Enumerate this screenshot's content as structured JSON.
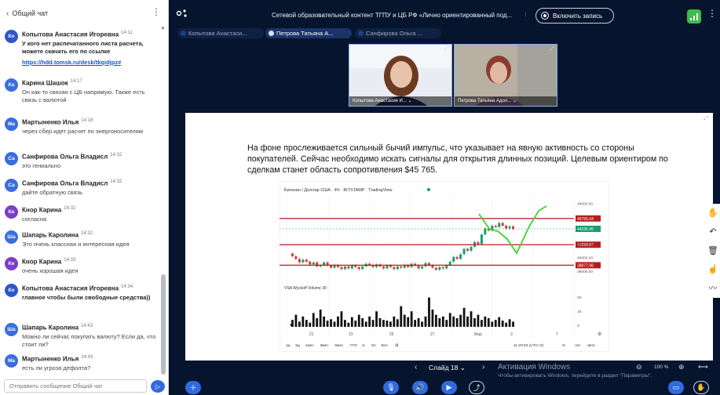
{
  "chat": {
    "title": "Общий чат",
    "back_icon": "chevron-left-icon",
    "input_placeholder": "Отправить сообщение Общий чат",
    "messages": [
      {
        "initials": "Ко",
        "color": "#2f56c9",
        "author": "Копытова Анастасия Игоревна",
        "time": "14:11",
        "text": "У кого нет распечатанного листа расчета, можете скачать его по ссылке",
        "bold": true,
        "link": "https://hdd.tomsk.ru/desk/tkqidjpz#"
      },
      {
        "initials": "Ка",
        "color": "#3a6ee0",
        "author": "Карина Шашок",
        "time": "14:17",
        "text": "Он как-то связан с ЦБ напрямую. Также есть связь с валютой",
        "bold": false
      },
      {
        "initials": "Ма",
        "color": "#3a6ee0",
        "author": "Мартыненко Илья",
        "time": "14:18",
        "text": "через сбер идет расчет по энергоносителям",
        "bold": false
      },
      {
        "initials": "Са",
        "color": "#3a6ee0",
        "author": "Санфирова Ольга Владисл",
        "time": "14:32",
        "text": "это гениально",
        "bold": false
      },
      {
        "initials": "Са",
        "color": "#3a6ee0",
        "author": "Санфирова Ольга Владисл",
        "time": "14:32",
        "text": "дайте обратную связь",
        "bold": false
      },
      {
        "initials": "Кн",
        "color": "#7a3fc4",
        "author": "Кнор Карина",
        "time": "14:32",
        "text": "согласна",
        "bold": false
      },
      {
        "initials": "Ша",
        "color": "#3a6ee0",
        "author": "Шапарь Каролина",
        "time": "14:32",
        "text": "Это очень классная и интересная идея",
        "bold": false
      },
      {
        "initials": "Кн",
        "color": "#7a3fc4",
        "author": "Кнор Карина",
        "time": "14:33",
        "text": "очень хорошая идея",
        "bold": false
      },
      {
        "initials": "Ко",
        "color": "#2f56c9",
        "author": "Копытова Анастасия Игоревна",
        "time": "14:34",
        "text": "главное чтобы были свободные средства))",
        "bold": true
      },
      {
        "initials": "Ша",
        "color": "#3a6ee0",
        "author": "Шапарь Каролина",
        "time": "14:43",
        "text": "Можно ли сейчас покупать валюту? Если да, что стоит ли?",
        "bold": false
      },
      {
        "initials": "Ма",
        "color": "#3a6ee0",
        "author": "Мартыненко Илья",
        "time": "14:43",
        "text": "есть ли угроза дефолта?",
        "bold": false
      }
    ]
  },
  "meeting": {
    "title": "Сетевой образовательный контент ТГПУ и ЦБ РФ «Лично ориентированный под...",
    "record_label": "Включить запись",
    "participant_tabs": [
      {
        "label": "Копытова Анастаси...",
        "active": false
      },
      {
        "label": "Петрова Татьяна А...",
        "active": true
      },
      {
        "label": "Санфирова Ольга ...",
        "active": false
      }
    ],
    "videos": [
      {
        "caption": "Копытова Анастасия И... ⌄"
      },
      {
        "caption": "Петрова Татьяна Адол... ⌄"
      }
    ]
  },
  "slide": {
    "paragraph": "На фоне прослеживается сильный бычий импульс, что указывает на явную активность со стороны покупателей. Сейчас необходимо искать сигналы для открытия длинных позиций. Целевым ориентиром по сделкам станет область сопротивления $45 765.",
    "nav_label": "Слайд 18",
    "activation_title": "Активация Windows",
    "activation_sub": "Чтобы активировать Windows, перейдите в раздел \"Параметры\".",
    "zoom": "100 %"
  },
  "chart_data": {
    "type": "bar",
    "title": "Биткоин / Доллар США · 4Ч · BITSTAMP · TradingView",
    "volume_label": "VSA Wyckoff Volume  30",
    "x_tick_labels": [
      "21",
      "23",
      "25",
      "27",
      "Мар",
      "3",
      "7"
    ],
    "y_tick_labels": [
      "48000.00",
      "46000.00",
      "44000.00",
      "42000.00",
      "40000.00",
      "38000.00"
    ],
    "volume_ticks": [
      "2K",
      "1K",
      "0"
    ],
    "levels": [
      {
        "label": "45765.04",
        "price": 45765,
        "color": "#b71c1c"
      },
      {
        "label": "44236.45",
        "price": 44236,
        "color": "#1a9b73"
      },
      {
        "label": "41898.87",
        "price": 41899,
        "color": "#b71c1c"
      },
      {
        "label": "38877.98",
        "price": 38878,
        "color": "#b71c1c"
      }
    ],
    "ylim": [
      36500,
      49200
    ],
    "timeframes": [
      "1д",
      "5д",
      "1мес",
      "3мес",
      "6мес",
      "YTD",
      "1г",
      "5л",
      "Все"
    ],
    "clock": "11:29:53 (UTC+3)",
    "scale_buttons": [
      "%",
      "лог",
      "авто"
    ]
  }
}
